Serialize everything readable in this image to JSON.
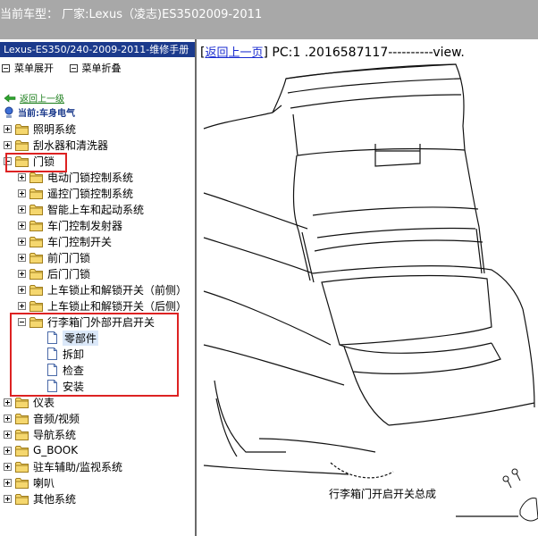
{
  "window": {
    "title": "当前车型： 厂家:Lexus（凌志)ES3502009-2011"
  },
  "left": {
    "header": "Lexus-ES350/240-2009-2011-维修手册",
    "actions": [
      "菜单展开",
      "菜单折叠"
    ],
    "back_label": "返回上一级",
    "current_label": "当前:车身电气",
    "tree": [
      {
        "label": "照明系统"
      },
      {
        "label": "刮水器和清洗器"
      },
      {
        "label": "门锁"
      },
      {
        "label": "电动门锁控制系统"
      },
      {
        "label": "遥控门锁控制系统"
      },
      {
        "label": "智能上车和起动系统"
      },
      {
        "label": "车门控制发射器"
      },
      {
        "label": "车门控制开关"
      },
      {
        "label": "前门门锁"
      },
      {
        "label": "后门门锁"
      },
      {
        "label": "上车锁止和解锁开关（前侧）"
      },
      {
        "label": "上车锁止和解锁开关（后侧）"
      },
      {
        "label": "行李箱门外部开启开关"
      },
      {
        "label": "零部件"
      },
      {
        "label": "拆卸"
      },
      {
        "label": "检查"
      },
      {
        "label": "安装"
      },
      {
        "label": "仪表"
      },
      {
        "label": "音频/视频"
      },
      {
        "label": "导航系统"
      },
      {
        "label": "G_BOOK"
      },
      {
        "label": "驻车辅助/监视系统"
      },
      {
        "label": "喇叭"
      },
      {
        "label": "其他系统"
      }
    ]
  },
  "right": {
    "bracket_open": "[",
    "back_link": "返回上一页",
    "bracket_close": "]",
    "pc_text": "PC:1 .2016587117----------view.",
    "caption": "行李箱门开启开关总成"
  },
  "colors": {
    "highlight_box": "#dd2222",
    "header_bg": "#1b3a8c",
    "topbar_bg": "#a8a8a8",
    "link": "#1a2bd0",
    "back_link": "#1a7d1a"
  }
}
